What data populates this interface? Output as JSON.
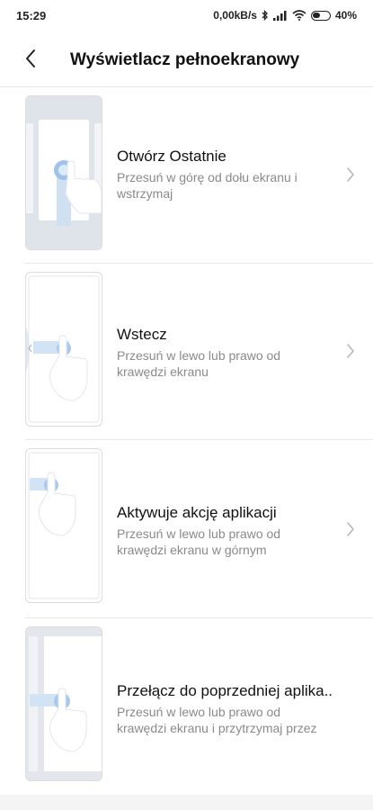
{
  "status": {
    "time": "15:29",
    "net_speed": "0,00kB/s",
    "battery": "40%",
    "icons": [
      "bluetooth-icon",
      "signal-icon",
      "wifi-icon",
      "battery-icon"
    ]
  },
  "header": {
    "title": "Wyświetlacz pełnoekranowy",
    "back_icon": "chevron-left-icon"
  },
  "items": [
    {
      "title": "Otwórz Ostatnie",
      "description": "Przesuń w górę od dołu ekranu i wstrzymaj"
    },
    {
      "title": "Wstecz",
      "description": "Przesuń w lewo lub prawo od krawędzi ekranu"
    },
    {
      "title": "Aktywuje akcję aplikacji",
      "description": "Przesuń w lewo lub prawo od krawędzi ekranu w górnym"
    },
    {
      "title": "Przełącz do poprzedniej aplika..",
      "description": "Przesuń w lewo lub prawo od krawędzi ekranu i przytrzymaj przez"
    }
  ],
  "colors": {
    "accent": "#bcd6f2",
    "secondary_text": "#8a8a8a",
    "divider": "#e8e8e8"
  }
}
